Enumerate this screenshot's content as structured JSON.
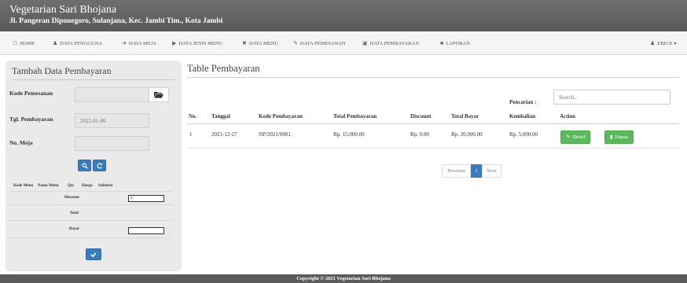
{
  "header": {
    "title": "Vegetarian Sari Bhojana",
    "subtitle": "Jl. Pangeran Diponegoro, Sulanjana, Kec. Jambi Tim., Kota Jambi"
  },
  "nav": {
    "items": [
      {
        "icon": "home-icon",
        "label": "HOME"
      },
      {
        "icon": "user-icon",
        "label": "DATA PENGGUNA"
      },
      {
        "icon": "table-icon",
        "label": "DATA MEJA"
      },
      {
        "icon": "tag-icon",
        "label": "DATA JENIS MENU"
      },
      {
        "icon": "cutlery-icon",
        "label": "DATA MENU"
      },
      {
        "icon": "pencil-icon",
        "label": "DATA PEMESANAN"
      },
      {
        "icon": "money-icon",
        "label": "DATA PEMBAYARAN"
      },
      {
        "icon": "report-icon",
        "label": "LAPORAN"
      }
    ],
    "user": "ERICK",
    "user_icon": "user-icon",
    "caret_icon": "caret-down-icon"
  },
  "form": {
    "title": "Tambah Data Pembayaran",
    "kode_label": "Kode Pemesanan",
    "kode_value": "",
    "tgl_label": "Tgl. Pembayaran",
    "tgl_value": "2022-01-06",
    "meja_label": "No. Meja",
    "meja_value": "",
    "search_icon": "search-icon",
    "refresh_icon": "refresh-icon",
    "folder_icon": "folder-open-icon",
    "mini_headers": [
      "Kode Menu",
      "Nama Menu",
      "Qty",
      "Harga",
      "Subtotal"
    ],
    "discount_label": "Discount",
    "discount_value": "0",
    "total_label": "Total",
    "bayar_label": "Bayar",
    "bayar_value": "",
    "submit_icon": "check-icon"
  },
  "table": {
    "title": "Table Pembayaran",
    "search_label": "Pencarian :",
    "search_placeholder": "Search..",
    "headers": [
      "No.",
      "Tanggal",
      "Kode Pembayaran",
      "Total Pembayaran",
      "Discount",
      "Total Bayar",
      "Kembalian",
      "Action"
    ],
    "rows": [
      {
        "no": "1",
        "tanggal": "2021-12-27",
        "kode": "NP/2021/0001",
        "total": "Rp. 15,000.00",
        "discount": "Rp. 0.00",
        "bayar": "Rp. 20,000.00",
        "kembalian": "Rp. 5,000.00"
      }
    ],
    "detail_label": "Detail",
    "hapus_label": "Hapus"
  },
  "pagination": {
    "previous": "Previous",
    "current": "1",
    "next": "Next"
  },
  "footer": {
    "text": "Copyright © 2021 Vegetarian Sari Bhojana"
  },
  "colors": {
    "header": "#5f5f5f",
    "primary": "#3a7bc0",
    "success": "#5cb85c"
  }
}
